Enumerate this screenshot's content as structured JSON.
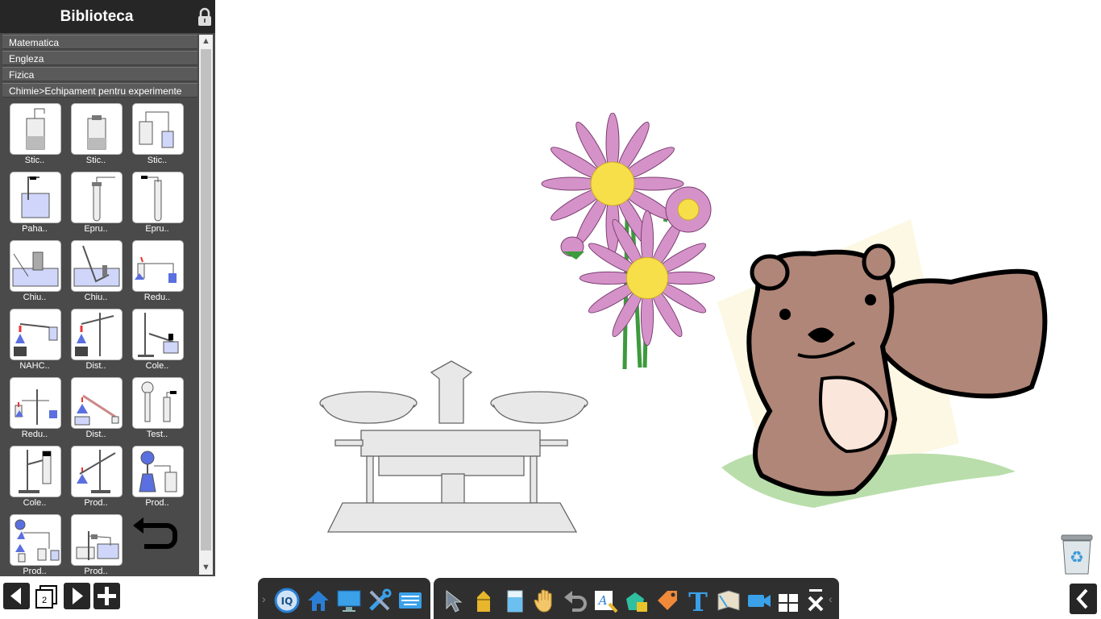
{
  "library": {
    "title": "Biblioteca",
    "categories": [
      "Matematica",
      "Engleza",
      "Fizica",
      "Chimie>Echipament pentru experimente"
    ],
    "items": [
      {
        "label": "Stic.."
      },
      {
        "label": "Stic.."
      },
      {
        "label": "Stic.."
      },
      {
        "label": "Paha.."
      },
      {
        "label": "Epru.."
      },
      {
        "label": "Epru.."
      },
      {
        "label": "Chiu.."
      },
      {
        "label": "Chiu.."
      },
      {
        "label": "Redu.."
      },
      {
        "label": "NAHC.."
      },
      {
        "label": "Dist.."
      },
      {
        "label": "Cole.."
      },
      {
        "label": "Redu.."
      },
      {
        "label": "Dist.."
      },
      {
        "label": "Test.."
      },
      {
        "label": "Cole.."
      },
      {
        "label": "Prod.."
      },
      {
        "label": "Prod.."
      },
      {
        "label": "Prod.."
      },
      {
        "label": "Prod.."
      }
    ]
  },
  "nav": {
    "page_number": "2"
  },
  "toolbar_left": [
    "iq-icon",
    "home-icon",
    "monitor-icon",
    "tools-icon",
    "keyboard-icon"
  ],
  "toolbar_right": [
    "pointer-icon",
    "pen-icon",
    "eraser-icon",
    "hand-icon",
    "undo-icon",
    "text-search-icon",
    "shapes-icon",
    "tag-icon",
    "text-icon",
    "book-icon",
    "camera-icon",
    "grid-close-icon"
  ],
  "colors": {
    "panel": "#4a4a4a",
    "header": "#262626",
    "toolbar": "#2f2f2f",
    "accent": "#2a7fd4"
  }
}
